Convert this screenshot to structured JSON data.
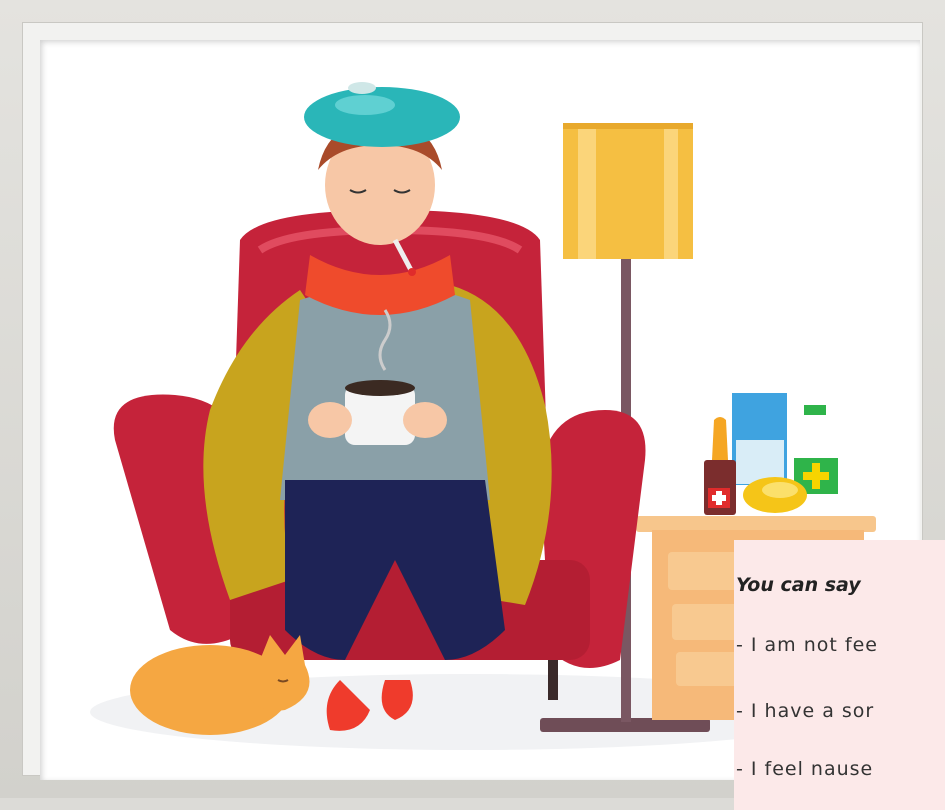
{
  "note": {
    "heading": "You can say",
    "lines": [
      "- I am not fee",
      "- I have a sor",
      "- I feel nause"
    ]
  },
  "icons": [
    "cat",
    "armchair",
    "floor-lamp",
    "nightstand",
    "medicine-bottle",
    "medicine-box",
    "lemon",
    "mug",
    "thermometer",
    "ice-pack"
  ],
  "colors": {
    "armchair": "#c5233a",
    "lampshade": "#f5bf42",
    "blanket": "#c8a41e",
    "ice_pack": "#2ab6b8",
    "scarf": "#ef4b2c",
    "note_bg": "#fce9e9"
  }
}
